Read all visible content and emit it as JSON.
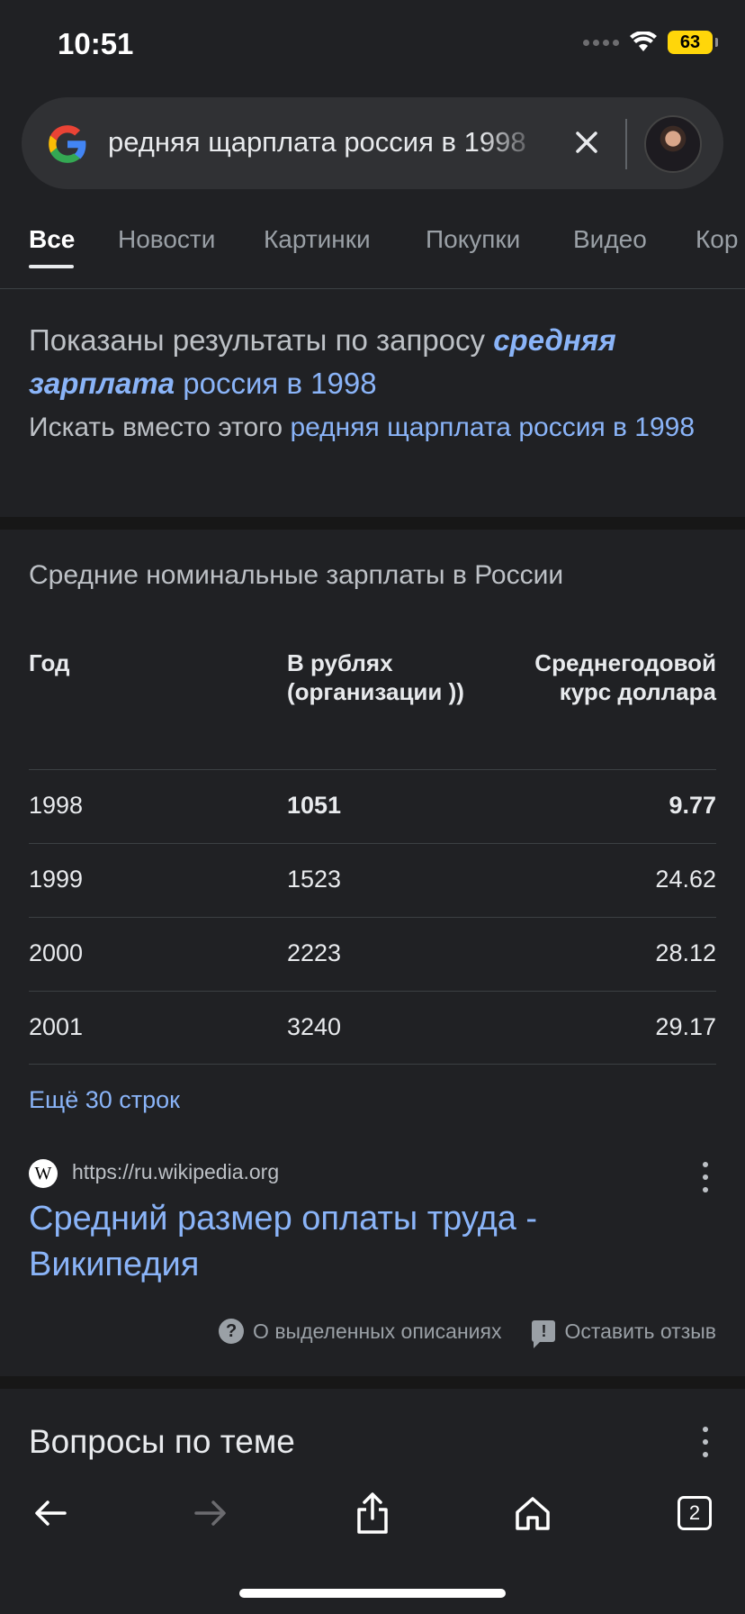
{
  "status_bar": {
    "time": "10:51",
    "battery": "63"
  },
  "search": {
    "query": "редняя щарплата россия в 1998",
    "clear_icon": "close-icon",
    "avatar": "user-avatar"
  },
  "tabs": [
    {
      "label": "Все",
      "active": true
    },
    {
      "label": "Новости"
    },
    {
      "label": "Картинки"
    },
    {
      "label": "Покупки"
    },
    {
      "label": "Видео"
    },
    {
      "label": "Кор"
    }
  ],
  "spelling": {
    "showing_prefix": "Показаны результаты по запросу",
    "corrected_bold": "средняя зарплата",
    "corrected_rest": "россия в 1998",
    "instead_prefix": "Искать вместо этого",
    "instead_link": "редняя щарплата россия в 1998"
  },
  "snippet": {
    "title": "Средние номинальные зарплаты в России",
    "headers": [
      "Год",
      "В рублях (организации ))",
      "Среднегодовой курс доллара"
    ],
    "rows": [
      [
        "1998",
        "1051",
        "9.77"
      ],
      [
        "1999",
        "1523",
        "24.62"
      ],
      [
        "2000",
        "2223",
        "28.12"
      ],
      [
        "2001",
        "3240",
        "29.17"
      ]
    ],
    "more_rows": "Ещё 30 строк",
    "source_icon_letter": "W",
    "source_url": "https://ru.wikipedia.org",
    "result_title": "Средний размер оплаты труда - Википедия",
    "about_featured": "О выделенных описаниях",
    "leave_feedback": "Оставить отзыв"
  },
  "related": {
    "title": "Вопросы по теме"
  },
  "toolbar": {
    "tabs_count": "2"
  },
  "colors": {
    "background": "#202124",
    "link": "#8ab4f8",
    "battery": "#ffd60a"
  }
}
